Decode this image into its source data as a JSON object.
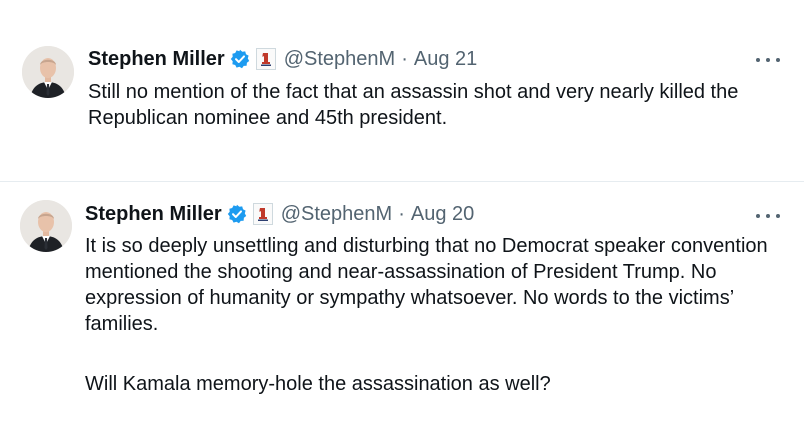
{
  "tweets": [
    {
      "author": "Stephen Miller",
      "handle": "@StephenM",
      "separator": "·",
      "date": "Aug 21",
      "text": "Still no mention of the fact that an assassin shot and very nearly killed the Republican nominee and 45th president.",
      "avatar_icon": "person-portrait-icon",
      "badge_icon": "verified-check-icon",
      "accent_color": "#1d9bf0"
    },
    {
      "author": "Stephen Miller",
      "handle": "@StephenM",
      "separator": "·",
      "date": "Aug 20",
      "paragraph1": "It is so deeply unsettling and disturbing that no Democrat speaker convention mentioned the shooting and near-assassination of President Trump. No expression of humanity or sympathy whatsoever. No words to the victims’ families.",
      "paragraph2": "Will Kamala memory-hole the assassination as well?",
      "avatar_icon": "person-portrait-icon",
      "badge_icon": "verified-check-icon",
      "accent_color": "#1d9bf0"
    }
  ],
  "more_icon": "more-options-icon"
}
